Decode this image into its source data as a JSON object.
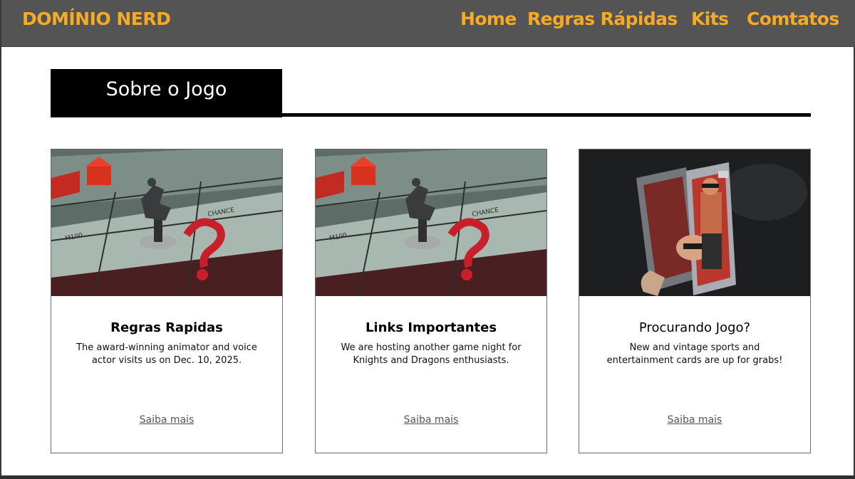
{
  "brand": "DOMÍNIO NERD",
  "nav": {
    "home": "Home",
    "regras": "Regras Rápidas",
    "kits": "Kits",
    "contatos": "Comtatos"
  },
  "section": {
    "title": "Sobre o Jogo"
  },
  "cards": [
    {
      "title": "Regras Rapidas",
      "text": "The award-winning animator and voice actor visits us on Dec. 10, 2025.",
      "link": "Saiba mais",
      "image": "monopoly-board-photo"
    },
    {
      "title": "Links Importantes",
      "text": "We are hosting another game night for Knights and Dragons enthusiasts.",
      "link": "Saiba mais",
      "image": "monopoly-board-photo"
    },
    {
      "title": "Procurando Jogo?",
      "text": "New and vintage sports and entertainment cards are up for grabs!",
      "link": "Saiba mais",
      "image": "action-figure-photo"
    }
  ],
  "colors": {
    "navbar_bg": "#545454",
    "accent": "#f7a928",
    "title_box": "#000000"
  }
}
